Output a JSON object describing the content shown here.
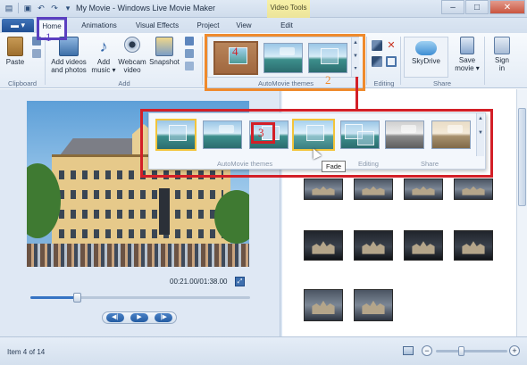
{
  "window": {
    "title": "My Movie - Windows Live Movie Maker",
    "contextual_tab": "Video Tools",
    "controls": {
      "minimize": "–",
      "maximize": "□",
      "close": "✕"
    }
  },
  "quick_access": {
    "save_icon": "save-icon",
    "undo_icon": "undo-icon",
    "redo_icon": "redo-icon"
  },
  "tabs": [
    {
      "label": "Home",
      "active": true
    },
    {
      "label": "Animations"
    },
    {
      "label": "Visual Effects"
    },
    {
      "label": "Project"
    },
    {
      "label": "View"
    },
    {
      "label": "Edit"
    }
  ],
  "ribbon": {
    "clipboard": {
      "paste": "Paste",
      "group": "Clipboard"
    },
    "add": {
      "add_videos_1": "Add videos",
      "add_videos_2": "and photos",
      "add_music_1": "Add",
      "add_music_2": "music ▾",
      "webcam_1": "Webcam",
      "webcam_2": "video",
      "snapshot": "Snapshot",
      "group": "Add"
    },
    "automovie": {
      "group": "AutoMovie themes"
    },
    "editing": {
      "group": "Editing"
    },
    "share": {
      "skydrive": "SkyDrive",
      "save_movie_1": "Save",
      "save_movie_2": "movie ▾",
      "sign_in_1": "Sign",
      "sign_in_2": "in",
      "group": "Share"
    }
  },
  "expanded_gallery": {
    "labels": {
      "themes": "AutoMovie themes",
      "editing": "Editing",
      "share": "Share"
    },
    "tooltip": "Fade",
    "scroll_up": "▲",
    "scroll_down": "▼"
  },
  "annotations": {
    "n1": "1",
    "n2": "2",
    "n3": "3",
    "n4": "4",
    "colors": {
      "purple": "#5a3fc0",
      "orange": "#ef8a2c",
      "red": "#d31f27"
    }
  },
  "preview": {
    "timecode": "00:21.00/01:38.00",
    "progress": 0.21,
    "expand_label": "⤢",
    "prev_label": "◀|",
    "play_label": "▶",
    "next_label": "|▶"
  },
  "status": {
    "item_text": "Item 4 of 14",
    "zoom_out": "−",
    "zoom_in": "+",
    "zoom_level": 0.35
  }
}
